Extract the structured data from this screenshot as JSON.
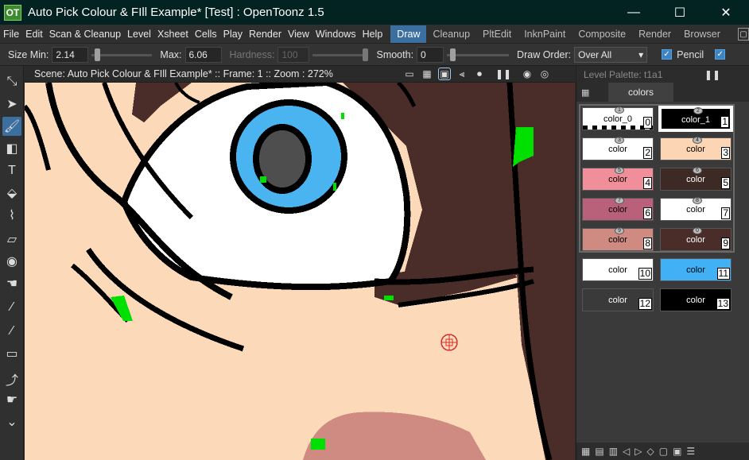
{
  "titlebar": {
    "logo_text": "OT",
    "title": "Auto Pick Colour & FIll Example* [Test] : OpenToonz 1.5",
    "minimize": "—",
    "maximize": "☐",
    "close": "✕"
  },
  "menu": {
    "items": [
      "File",
      "Edit",
      "Scan & Cleanup",
      "Level",
      "Xsheet",
      "Cells",
      "Play",
      "Render",
      "View",
      "Windows",
      "Help"
    ],
    "rooms": [
      "Draw",
      "Cleanup",
      "PltEdit",
      "InknPaint",
      "Composite",
      "Render",
      "Browser"
    ],
    "active_room": "Draw",
    "more": "▢"
  },
  "tool_options": {
    "size_min_label": "Size Min:",
    "size_min_value": "2.14",
    "max_label": "Max:",
    "max_value": "6.06",
    "hardness_label": "Hardness:",
    "hardness_value": "100",
    "smooth_label": "Smooth:",
    "smooth_value": "0",
    "draw_order_label": "Draw Order:",
    "draw_order_value": "Over All",
    "pencil_label": "Pencil",
    "pencil_checked": true
  },
  "toolbar": {
    "tools": [
      {
        "name": "animate-tool-icon",
        "glyph": "⤡"
      },
      {
        "name": "selection-tool-icon",
        "glyph": "➤"
      },
      {
        "name": "brush-tool-icon",
        "glyph": "🖌",
        "active": true
      },
      {
        "name": "geometric-tool-icon",
        "glyph": "◧"
      },
      {
        "name": "type-tool-icon",
        "glyph": "T"
      },
      {
        "name": "fill-tool-icon",
        "glyph": "⬙"
      },
      {
        "name": "paint-brush-tool-icon",
        "glyph": "⌇"
      },
      {
        "name": "eraser-tool-icon",
        "glyph": "▱"
      },
      {
        "name": "tape-tool-icon",
        "glyph": "◉"
      },
      {
        "name": "finger-tool-icon",
        "glyph": "☚"
      },
      {
        "name": "style-picker-tool-icon",
        "glyph": "⁄"
      },
      {
        "name": "rgb-picker-tool-icon",
        "glyph": "⁄"
      },
      {
        "name": "ruler-tool-icon",
        "glyph": "▭"
      },
      {
        "name": "control-point-editor-icon",
        "glyph": "⤴"
      },
      {
        "name": "pinch-tool-icon",
        "glyph": "☛"
      },
      {
        "name": "more-tools-icon",
        "glyph": "⌄"
      }
    ]
  },
  "viewer": {
    "title": "Scene: Auto Pick Colour & FIll Example*  ::  Frame: 1  ::  Zoom : 272%"
  },
  "palette": {
    "title": "Level Palette: t1a1",
    "pause": "❚❚",
    "tab": "colors",
    "chips": [
      {
        "index": "0",
        "name": "color_0",
        "bg": "#ffffff",
        "fg": "#000000",
        "style": "1"
      },
      {
        "index": "1",
        "name": "color_1",
        "bg": "#000000",
        "fg": "#ffffff",
        "style": "2"
      },
      {
        "index": "2",
        "name": "color",
        "bg": "#ffffff",
        "fg": "#000000",
        "style": "3"
      },
      {
        "index": "3",
        "name": "color",
        "bg": "#fcd5b5",
        "fg": "#000000",
        "style": "4"
      },
      {
        "index": "4",
        "name": "color",
        "bg": "#f08f9a",
        "fg": "#000000",
        "style": "5"
      },
      {
        "index": "5",
        "name": "color",
        "bg": "#3e2a25",
        "fg": "#ffffff",
        "style": "6"
      },
      {
        "index": "6",
        "name": "color",
        "bg": "#b9607a",
        "fg": "#000000",
        "style": "7"
      },
      {
        "index": "7",
        "name": "color",
        "bg": "#ffffff",
        "fg": "#000000",
        "style": "8"
      },
      {
        "index": "8",
        "name": "color",
        "bg": "#cf8a81",
        "fg": "#000000",
        "style": "9"
      },
      {
        "index": "9",
        "name": "color",
        "bg": "#4a2d28",
        "fg": "#ffffff",
        "style": "0"
      },
      {
        "index": "10",
        "name": "color",
        "bg": "#ffffff",
        "fg": "#000000"
      },
      {
        "index": "11",
        "name": "color",
        "bg": "#42b0f5",
        "fg": "#000000"
      },
      {
        "index": "12",
        "name": "color",
        "bg": "#3a3a3a",
        "fg": "#ffffff"
      },
      {
        "index": "13",
        "name": "color",
        "bg": "#000000",
        "fg": "#ffffff"
      }
    ]
  },
  "colors": {
    "skin": "#fcd9b9",
    "hair": "#4a2d28",
    "iris": "#4ab4f0",
    "pupil": "#4e4e4e",
    "lips": "#cf8a81",
    "ink": "#000000",
    "fill_marker": "#00e000",
    "accent": "#3b6fa0"
  }
}
